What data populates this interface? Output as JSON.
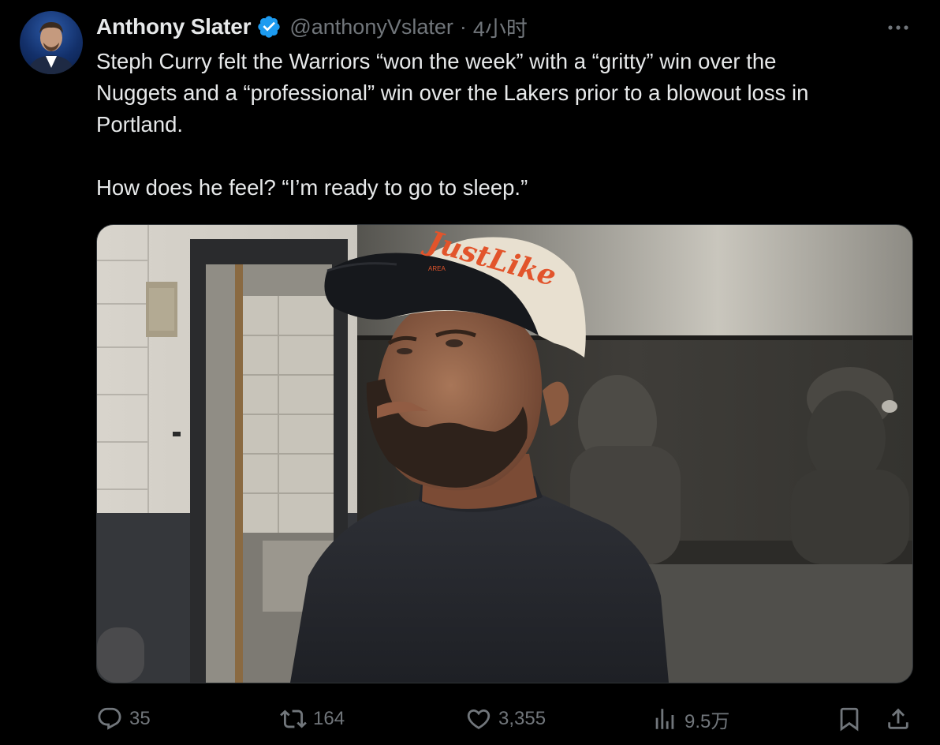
{
  "author": {
    "name": "Anthony Slater",
    "handle": "@anthonyVslater",
    "separator": "·",
    "time": "4小时"
  },
  "tweet": {
    "line1": "Steph Curry felt the Warriors “won the week” with a “gritty” win over the",
    "line2": "Nuggets and a “professional” win over the Lakers prior to a blowout loss in",
    "line3": "Portland.",
    "line4": "How does he feel? “I’m ready to go to sleep.”"
  },
  "media": {
    "cap_text": "JustLike",
    "cap_subtext": "AREA"
  },
  "actions": {
    "replies": "35",
    "reposts": "164",
    "likes": "3,355",
    "views": "9.5万"
  },
  "icons": [
    "verified-badge-icon",
    "more-icon",
    "reply-icon",
    "repost-icon",
    "like-icon",
    "views-icon",
    "bookmark-icon",
    "share-icon"
  ],
  "colors": {
    "background": "#000000",
    "text": "#e7e9ea",
    "muted": "#71767b",
    "verified": "#1d9bf0",
    "cap_logo": "#e2542b"
  }
}
